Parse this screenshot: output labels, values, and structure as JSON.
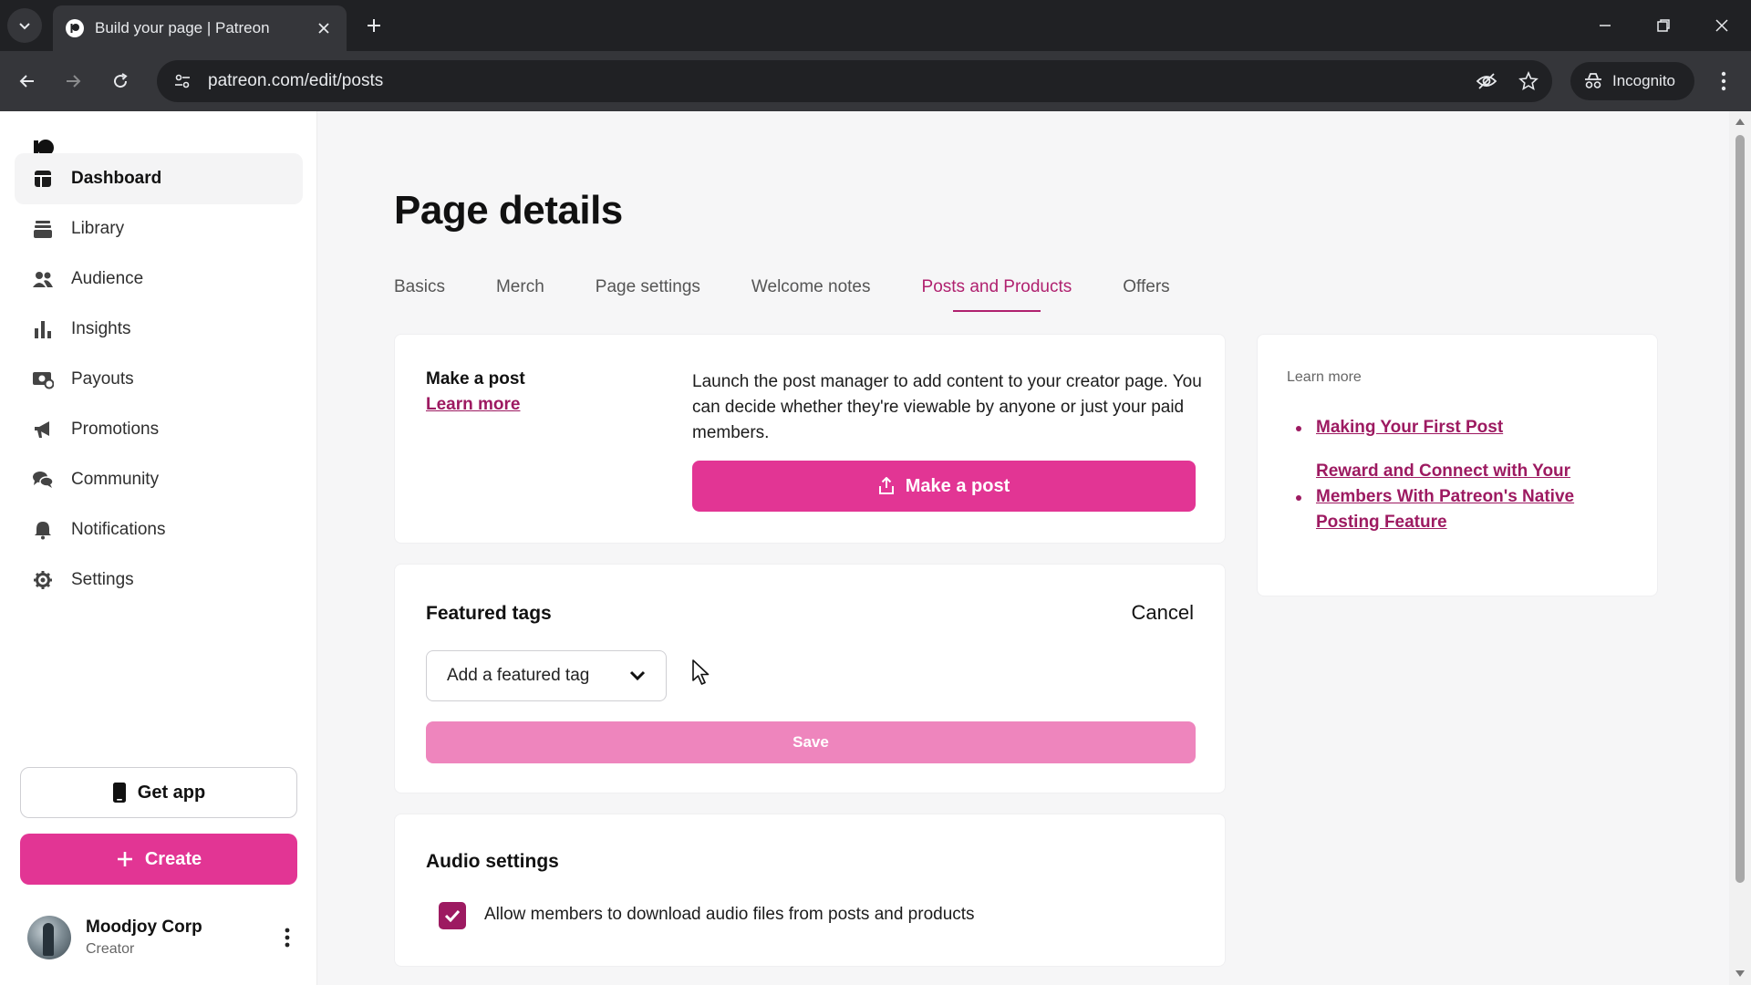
{
  "browser": {
    "tab_title": "Build your page | Patreon",
    "url": "patreon.com/edit/posts",
    "incognito_label": "Incognito"
  },
  "sidebar": {
    "items": [
      {
        "label": "Dashboard",
        "icon": "dashboard-icon",
        "active": true
      },
      {
        "label": "Library",
        "icon": "library-icon"
      },
      {
        "label": "Audience",
        "icon": "audience-icon"
      },
      {
        "label": "Insights",
        "icon": "insights-icon"
      },
      {
        "label": "Payouts",
        "icon": "payouts-icon"
      },
      {
        "label": "Promotions",
        "icon": "megaphone-icon"
      },
      {
        "label": "Community",
        "icon": "chat-icon"
      },
      {
        "label": "Notifications",
        "icon": "bell-icon"
      },
      {
        "label": "Settings",
        "icon": "gear-icon"
      }
    ],
    "get_app_label": "Get app",
    "create_label": "Create",
    "profile": {
      "name": "Moodjoy Corp",
      "role": "Creator"
    }
  },
  "main": {
    "title": "Page details",
    "tabs": [
      {
        "label": "Basics"
      },
      {
        "label": "Merch"
      },
      {
        "label": "Page settings"
      },
      {
        "label": "Welcome notes"
      },
      {
        "label": "Posts and Products",
        "active": true
      },
      {
        "label": "Offers"
      }
    ],
    "make_post": {
      "heading": "Make a post",
      "learn_more": "Learn more",
      "description": "Launch the post manager to add content to your creator page. You can decide whether they're viewable by anyone or just your paid members.",
      "button_label": "Make a post"
    },
    "featured_tags": {
      "heading": "Featured tags",
      "cancel_label": "Cancel",
      "select_placeholder": "Add a featured tag",
      "save_label": "Save"
    },
    "audio_settings": {
      "heading": "Audio settings",
      "checkbox_label": "Allow members to download audio files from posts and products",
      "checked": true
    },
    "learn_more_panel": {
      "heading": "Learn more",
      "links": [
        "Making Your First Post",
        "Reward and Connect with Your Members With Patreon's Native Posting Feature"
      ]
    }
  },
  "colors": {
    "brand_pink": "#e23594",
    "link": "#9d1a61",
    "save_disabled": "#ee85bd"
  }
}
